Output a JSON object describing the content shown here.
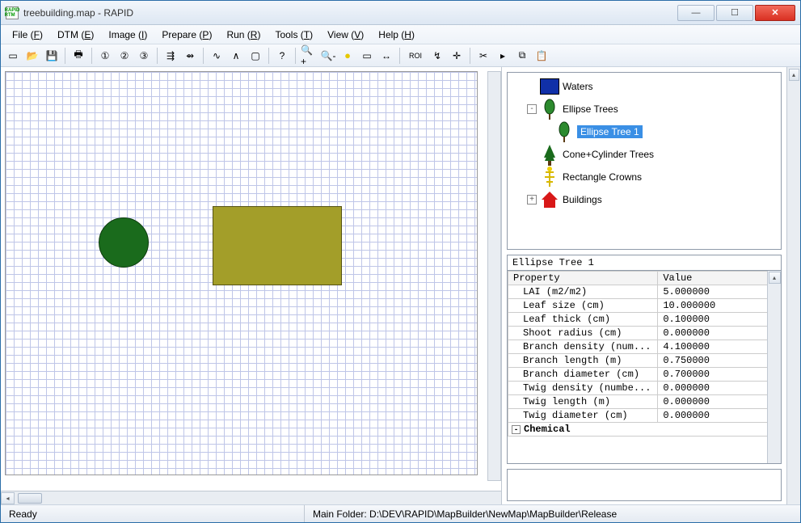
{
  "window": {
    "title": "treebuilding.map - RAPID"
  },
  "menu": [
    {
      "label": "File",
      "key": "F"
    },
    {
      "label": "DTM",
      "key": "E"
    },
    {
      "label": "Image",
      "key": "I"
    },
    {
      "label": "Prepare",
      "key": "P"
    },
    {
      "label": "Run",
      "key": "R"
    },
    {
      "label": "Tools",
      "key": "T"
    },
    {
      "label": "View",
      "key": "V"
    },
    {
      "label": "Help",
      "key": "H"
    }
  ],
  "toolbar": {
    "buttons": [
      "new",
      "open",
      "save",
      "|",
      "print",
      "|",
      "n1",
      "n2",
      "n3",
      "|",
      "hier1",
      "hier2",
      "|",
      "curve",
      "graph",
      "rect",
      "|",
      "help",
      "|",
      "zoom-in",
      "zoom-out",
      "circle-tool",
      "sel-rect",
      "swap",
      "|",
      "roi",
      "polyline",
      "cross",
      "|",
      "cut",
      "play",
      "copy",
      "paste"
    ],
    "roi_label": "ROI"
  },
  "tree": {
    "nodes": [
      {
        "label": "Waters",
        "indent": 1,
        "icon": "water"
      },
      {
        "label": "Ellipse Trees",
        "indent": 1,
        "icon": "ellipse-tree",
        "expander": "-"
      },
      {
        "label": "Ellipse Tree 1",
        "indent": 2,
        "icon": "ellipse-tree",
        "selected": true
      },
      {
        "label": "Cone+Cylinder Trees",
        "indent": 1,
        "icon": "cone-tree"
      },
      {
        "label": "Rectangle Crowns",
        "indent": 1,
        "icon": "rect-crown"
      },
      {
        "label": "Buildings",
        "indent": 1,
        "icon": "building",
        "expander": "+"
      }
    ]
  },
  "selected_object": {
    "title": "Ellipse Tree 1"
  },
  "property_grid": {
    "headers": {
      "name": "Property",
      "value": "Value"
    },
    "rows": [
      {
        "name": "LAI (m2/m2)",
        "value": "5.000000"
      },
      {
        "name": "Leaf size (cm)",
        "value": "10.000000"
      },
      {
        "name": "Leaf thick (cm)",
        "value": "0.100000"
      },
      {
        "name": "Shoot radius (cm)",
        "value": "0.000000"
      },
      {
        "name": "Branch density (num...",
        "value": "4.100000"
      },
      {
        "name": "Branch length (m)",
        "value": "0.750000"
      },
      {
        "name": "Branch diameter (cm)",
        "value": "0.700000"
      },
      {
        "name": "Twig density (numbe...",
        "value": "0.000000"
      },
      {
        "name": "Twig length (m)",
        "value": "0.000000"
      },
      {
        "name": "Twig diameter (cm)",
        "value": "0.000000"
      }
    ],
    "group": "Chemical"
  },
  "status": {
    "left": "Ready",
    "right": "Main Folder: D:\\DEV\\RAPID\\MapBuilder\\NewMap\\MapBuilder\\Release"
  }
}
